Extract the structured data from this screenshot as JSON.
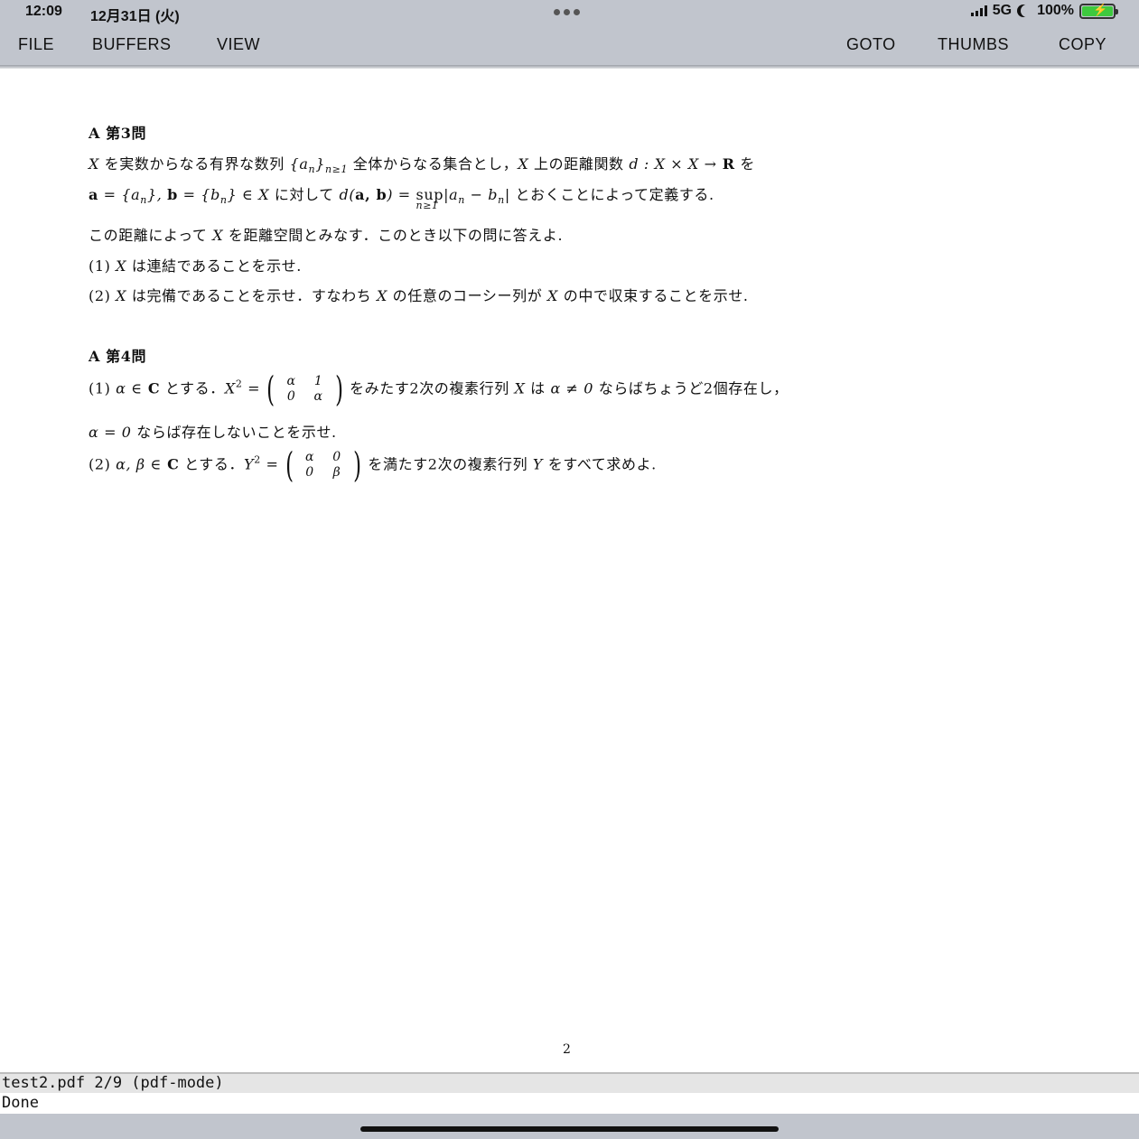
{
  "status": {
    "time": "12:09",
    "date": "12月31日 (火)",
    "network": "5G",
    "battery": "100%"
  },
  "menu": {
    "left": [
      "FILE",
      "BUFFERS",
      "VIEW"
    ],
    "right": [
      "GOTO",
      "THUMBS",
      "COPY"
    ]
  },
  "document": {
    "p3": {
      "heading": "A 第3問",
      "l1a": "X",
      "l1b": " を実数からなる有界な数列 ",
      "l1c": "{a",
      "l1d": "n",
      "l1e": "}",
      "l1f": "n≥1",
      "l1g": " 全体からなる集合とし，",
      "l1h": "X",
      "l1i": " 上の距離関数 ",
      "l1j": "d : X × X →",
      "l1k": " R",
      "l1l": " を",
      "l2a": "a",
      "l2b": " = {a",
      "l2c": "n",
      "l2d": "}, ",
      "l2e": "b",
      "l2f": " = {b",
      "l2g": "n",
      "l2h": "} ∈ X",
      "l2i": " に対して ",
      "l2j": "d(",
      "l2k": "a, b",
      "l2l": ") = ",
      "l2m": "sup",
      "l2n": "n≥1",
      "l2o": "|a",
      "l2p": "n",
      "l2q": " − b",
      "l2r": "n",
      "l2s": "|",
      "l2t": " とおくことによって定義する.",
      "l3a": "この距離によって ",
      "l3b": "X",
      "l3c": " を距離空間とみなす．このとき以下の問に答えよ.",
      "q1a": "(1) ",
      "q1b": "X",
      "q1c": " は連結であることを示せ.",
      "q2a": "(2) ",
      "q2b": "X",
      "q2c": " は完備であることを示せ．すなわち ",
      "q2d": "X",
      "q2e": " の任意のコーシー列が ",
      "q2f": "X",
      "q2g": " の中で収束することを示せ."
    },
    "p4": {
      "heading": "A 第4問",
      "q1a": "(1) ",
      "q1b": "α ∈",
      "q1c": " C",
      "q1d": " とする．",
      "q1e": "X",
      "q1f": "2",
      "q1g": " =",
      "m1": [
        "α",
        "1",
        "0",
        "α"
      ],
      "q1h": "をみたす2次の複素行列 ",
      "q1i": "X",
      "q1j": " は ",
      "q1k": "α ≠ 0",
      "q1l": " ならばちょうど2個存在し，",
      "q1m": "α = 0",
      "q1n": " ならば存在しないことを示せ.",
      "q2a": "(2) ",
      "q2b": "α, β ∈",
      "q2c": " C",
      "q2d": " とする．",
      "q2e": "Y",
      "q2f": "2",
      "q2g": " =",
      "m2": [
        "α",
        "0",
        "0",
        "β"
      ],
      "q2h": "を満たす2次の複素行列 ",
      "q2i": "Y",
      "q2j": " をすべて求めよ."
    },
    "page_number": "2"
  },
  "modeline": "test2.pdf 2/9 (pdf-mode)",
  "echo": "Done"
}
